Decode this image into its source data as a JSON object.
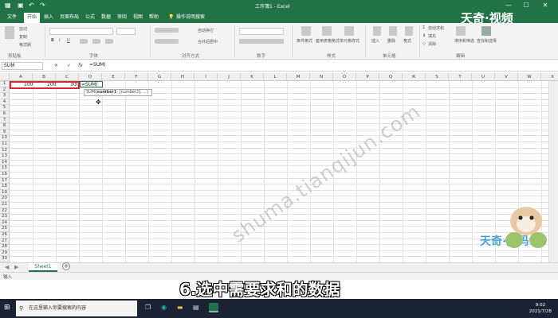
{
  "window": {
    "title": "工作簿1 - Excel",
    "min": "—",
    "max": "☐",
    "close": "✕"
  },
  "tabs": [
    "文件",
    "开始",
    "插入",
    "页面布局",
    "公式",
    "数据",
    "审阅",
    "视图",
    "帮助",
    "操作说明搜索"
  ],
  "active_tab": "开始",
  "ribbon": {
    "clipboard": {
      "cut": "剪切",
      "copy": "复制",
      "format_painter": "格式刷",
      "label": "剪贴板"
    },
    "font_label": "字体",
    "alignment": {
      "wrap": "自动换行",
      "merge": "合并后居中",
      "label": "对齐方式"
    },
    "number_label": "数字",
    "styles": {
      "conditional": "条件格式",
      "table": "套用表格格式",
      "cell_styles": "单元格样式",
      "label": "样式"
    },
    "cells": {
      "insert": "插入",
      "delete": "删除",
      "format": "格式",
      "label": "单元格"
    },
    "editing": {
      "autosum": "自动求和",
      "fill": "填充",
      "clear": "清除",
      "sort": "排序和筛选",
      "find": "查找和选择",
      "label": "编辑"
    }
  },
  "formula_bar": {
    "name_box": "SUM",
    "cancel": "✕",
    "enter": "✓",
    "fx": "fx",
    "formula": "=SUM("
  },
  "columns": [
    "A",
    "B",
    "C",
    "D",
    "E",
    "F",
    "G",
    "H",
    "I",
    "J",
    "K",
    "L",
    "M",
    "N",
    "O",
    "P",
    "Q",
    "R",
    "S",
    "T",
    "U",
    "V",
    "W",
    "X"
  ],
  "rows": [
    "1",
    "2",
    "3",
    "4",
    "5",
    "6",
    "7",
    "8",
    "9",
    "10",
    "11",
    "12",
    "13",
    "14",
    "15",
    "16",
    "17",
    "18",
    "19",
    "20",
    "21",
    "22",
    "23",
    "24",
    "25",
    "26",
    "27",
    "28",
    "29",
    "30"
  ],
  "cells": {
    "A1": "100",
    "B1": "200",
    "C1": "300",
    "D1": "=SUM("
  },
  "tooltip": {
    "fn": "SUM(",
    "arg1": "number1",
    "rest": ", [number2], ...)"
  },
  "sheet_tab": "Sheet1",
  "add_sheet": "+",
  "status": {
    "mode": "输入"
  },
  "taskbar": {
    "search_placeholder": "在这里输入你要搜索的内容",
    "time": "9:02",
    "date": "2021/7/28"
  },
  "overlay": {
    "watermark": "shuma.tianqijun.com",
    "caption": "6.选中需要求和的数据",
    "logo_top": "天奇·视频",
    "logo_bottom": "天奇·数码"
  },
  "colors": {
    "excel_green": "#217346",
    "selection_red": "#d8262c"
  }
}
